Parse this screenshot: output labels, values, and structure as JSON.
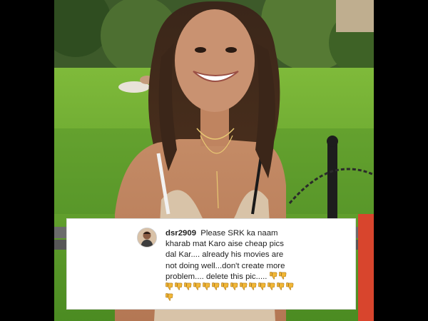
{
  "comment": {
    "username": "dsr2909",
    "text": "Please SRK ka naam kharab mat Karo aise cheap pics dal Kar.... already his movies are not doing well...don't create more problem.... delete this pic.....",
    "thumbs_down_count": 17,
    "thumbs_down_icon": "thumbs-down-icon",
    "avatar_icon": "avatar"
  },
  "colors": {
    "emoji_yellow": "#f2b736",
    "lawn_green": "#5f9a2a",
    "card_background": "#ffffff",
    "frame_background": "#000000"
  }
}
